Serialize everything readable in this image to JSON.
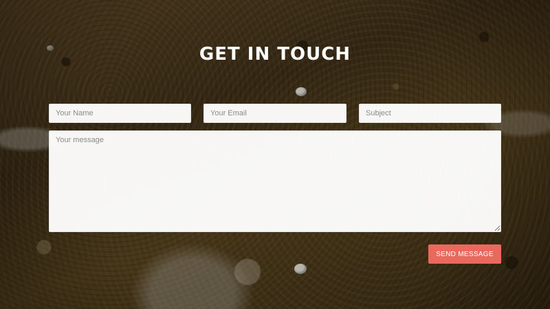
{
  "contact": {
    "heading": "GET IN TOUCH",
    "name_placeholder": "Your Name",
    "email_placeholder": "Your Email",
    "subject_placeholder": "Subject",
    "message_placeholder": "Your message",
    "send_label": "SEND MESSAGE"
  },
  "colors": {
    "button": "#e96a5c",
    "heading": "#ffffff",
    "field_background": "#f7f7f7"
  }
}
